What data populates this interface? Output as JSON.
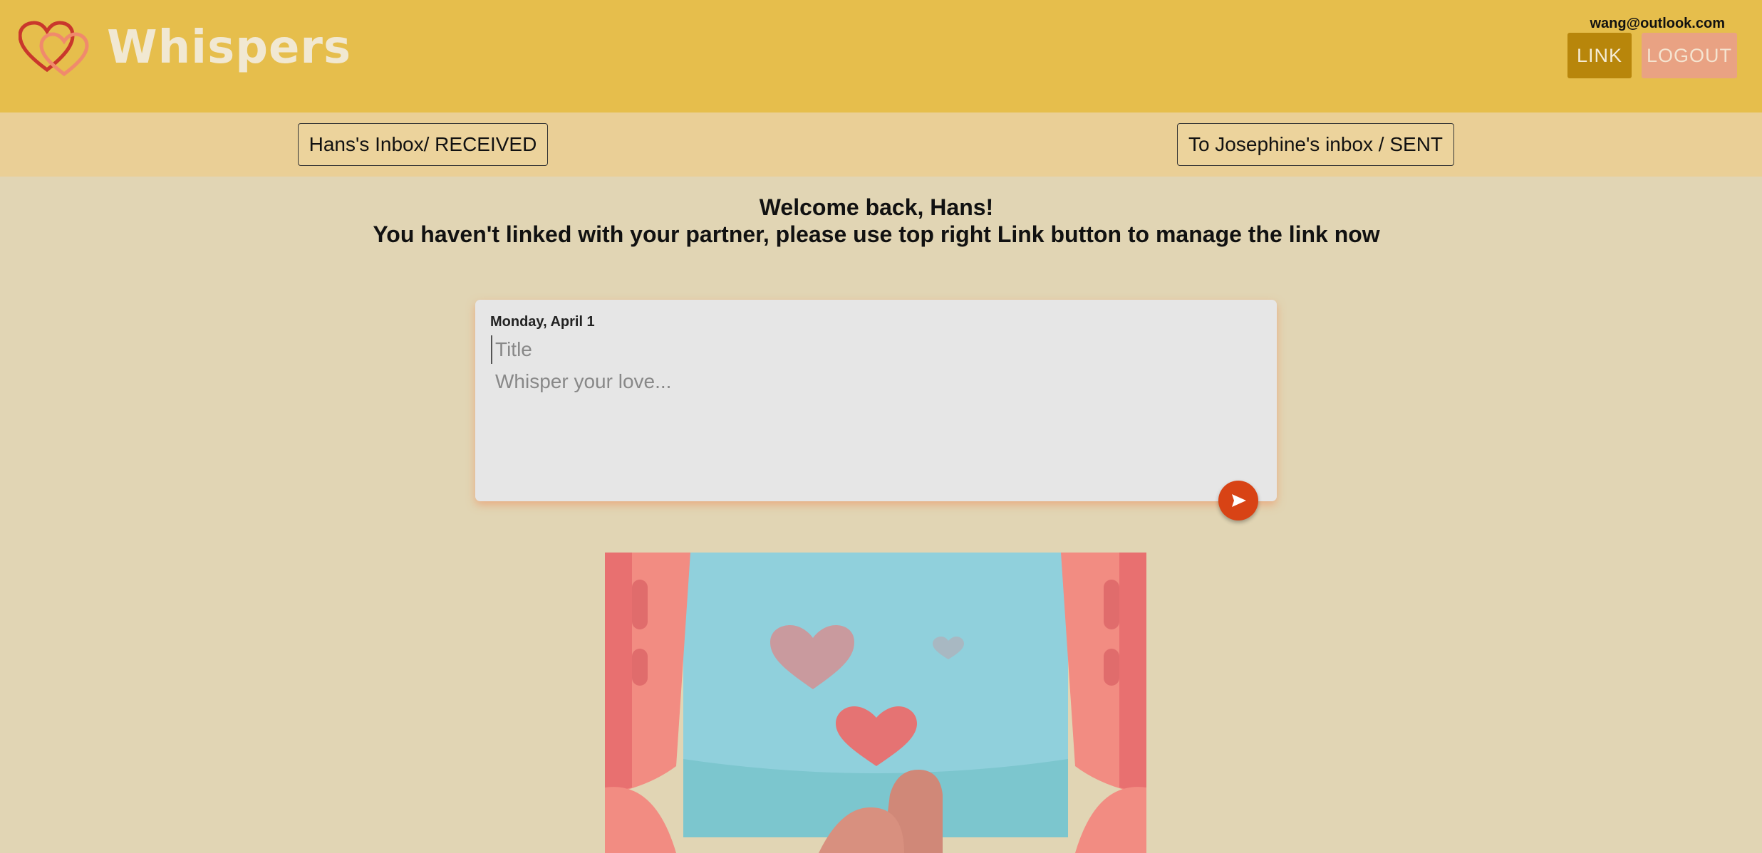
{
  "app": {
    "name": "Whispers"
  },
  "header": {
    "email": "wang@outlook.com",
    "link_label": "LINK",
    "logout_label": "LOGOUT"
  },
  "tabs": {
    "inbox_label": "Hans's Inbox/ RECEIVED",
    "sent_label": "To Josephine's inbox / SENT"
  },
  "welcome": {
    "line1": "Welcome back, Hans!",
    "line2": "You haven't linked with your partner, please use top right Link button to manage the link now"
  },
  "composer": {
    "date": "Monday, April 1",
    "title_placeholder": "Title",
    "body_placeholder": "Whisper your love...",
    "send_icon": "send-icon"
  },
  "colors": {
    "header_bg": "#e6be4c",
    "tabbar_bg": "#eacf96",
    "page_bg": "#e1d5b4",
    "link_button": "#b8860b",
    "logout_button": "#e9a283",
    "send_button": "#d84315"
  }
}
